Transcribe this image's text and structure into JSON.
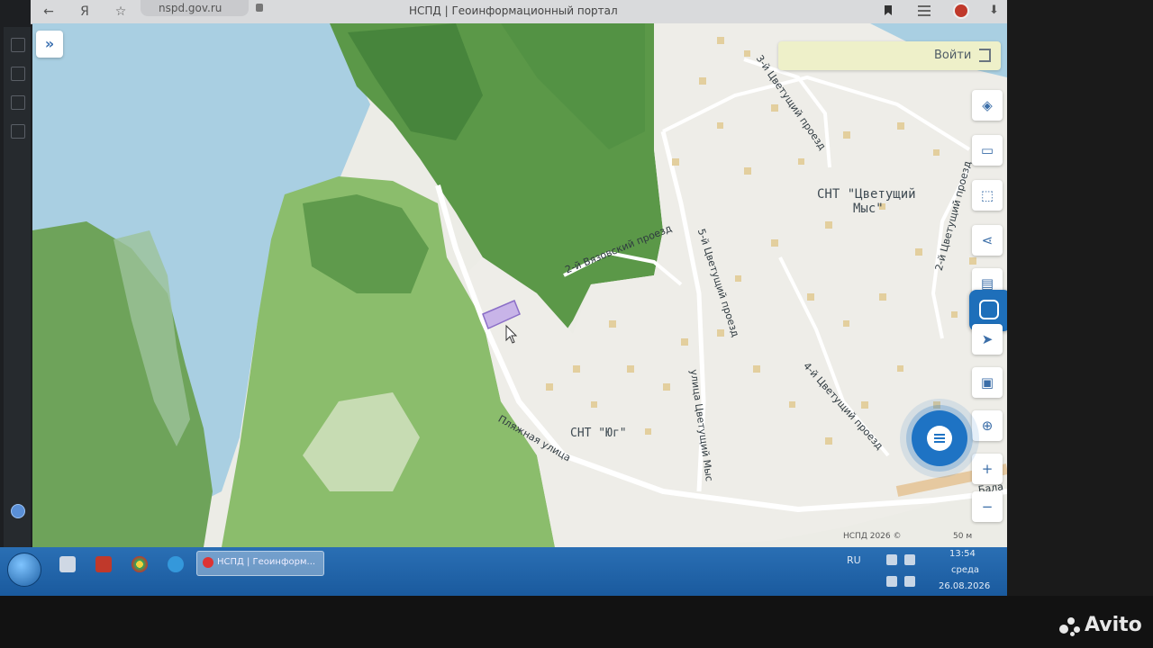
{
  "browser": {
    "url": "nspd.gov.ru",
    "title": "НСПД | Геоинформационный портал"
  },
  "map": {
    "login_label": "Войти",
    "place_labels": {
      "snt_cvetushchiy_line1": "СНТ \"Цветущий",
      "snt_cvetushchiy_line2": "Мыс\"",
      "snt_yug": "СНТ \"Юг\""
    },
    "street_labels": {
      "vyazovskiy": "2-й Вязовский проезд",
      "cvetushchiy_5": "5-й Цветущий проезд",
      "cvetushchiy_3": "3-й Цветущий проезд",
      "cvetushchiy_2": "2-й Цветущий проезд",
      "cvetushchiy_4": "4-й Цветущий проезд",
      "ulitsa_cvetushchiy_mys": "улица Цветущий Мыс",
      "plyazhnaya": "Пляжная улица",
      "bala": "Бала"
    },
    "copyright": "НСПД 2026 ©",
    "scale": "50 м"
  },
  "taskbar": {
    "task_item_label": "НСПД | Геоинформ...",
    "language": "RU",
    "time": "13:54",
    "day": "среда",
    "date": "26.08.2026"
  },
  "watermark": {
    "brand": "Avito"
  },
  "icons": {
    "layers": "layers-icon",
    "ruler": "ruler-icon",
    "select": "select-area-icon",
    "share": "share-icon",
    "print": "print-icon",
    "locate": "locate-icon",
    "minimap": "minimap-icon",
    "zoom_in": "zoom-in-icon",
    "zoom_out": "zoom-out-icon"
  },
  "colors": {
    "accent": "#1e6fba",
    "water": "#a9cfe2",
    "forest": "#5e9a4a",
    "parcel": "#c8b4e8"
  }
}
